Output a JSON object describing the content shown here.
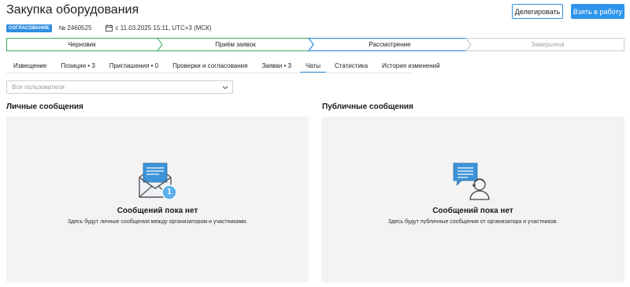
{
  "header": {
    "title": "Закупка оборудования",
    "delegate_label": "Делегировать",
    "take_label": "Взять в работу"
  },
  "meta": {
    "badge": "СОГЛАСОВАНИЕ",
    "number": "№ 2460525",
    "date": "с 11.03.2025 15:11, UTC+3 (МСК)"
  },
  "stepper": {
    "steps": [
      {
        "label": "Черновик",
        "state": "done"
      },
      {
        "label": "Приём заявок",
        "state": "done"
      },
      {
        "label": "Рассмотрение",
        "state": "current"
      },
      {
        "label": "Завершена",
        "state": "future"
      }
    ]
  },
  "tabs": [
    {
      "label": "Извещение"
    },
    {
      "label": "Позиции • 3"
    },
    {
      "label": "Приглашения • 0"
    },
    {
      "label": "Проверки и согласования"
    },
    {
      "label": "Заявки • 3"
    },
    {
      "label": "Чаты",
      "active": true
    },
    {
      "label": "Статистика"
    },
    {
      "label": "История изменений"
    }
  ],
  "filter": {
    "placeholder": "Все пользователи"
  },
  "private": {
    "title": "Личные сообщения",
    "empty_title": "Сообщений пока нет",
    "empty_text": "Здесь будут личные сообщения между организатором и участниками.",
    "badge_count": "1"
  },
  "public": {
    "title": "Публичные сообщения",
    "empty_title": "Сообщений пока нет",
    "empty_text": "Здесь будут публичные сообщения от организатора и участников."
  },
  "colors": {
    "accent": "#2e8fe0",
    "panel_bg": "#f3f3f3",
    "step_future_text": "#a0a0a0"
  }
}
